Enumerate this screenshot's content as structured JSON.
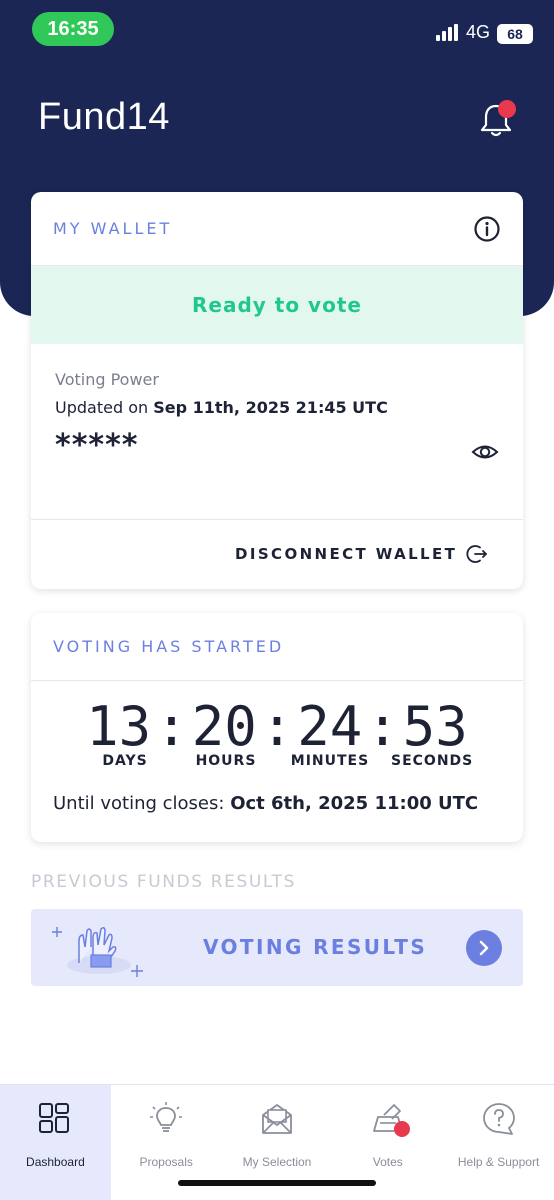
{
  "status_bar": {
    "time": "16:35",
    "network": "4G",
    "battery": "68"
  },
  "header": {
    "title": "Fund14",
    "bell_icon": "bell-icon"
  },
  "wallet": {
    "title": "MY WALLET",
    "status": "Ready to vote",
    "voting_power_label": "Voting Power",
    "updated_prefix": "Updated on",
    "updated_date": "Sep 11th, 2025 21:45 UTC",
    "voting_power_value": "*****",
    "disconnect_label": "DISCONNECT WALLET"
  },
  "voting": {
    "title": "VOTING HAS STARTED",
    "days": "13",
    "hours": "20",
    "minutes": "24",
    "seconds": "53",
    "days_label": "DAYS",
    "hours_label": "HOURS",
    "minutes_label": "MINUTES",
    "seconds_label": "SECONDS",
    "until_prefix": "Until voting closes:",
    "until_date": "Oct 6th, 2025 11:00 UTC"
  },
  "previous": {
    "title": "PREVIOUS FUNDS RESULTS",
    "banner_label": "VOTING RESULTS"
  },
  "nav": {
    "items": [
      {
        "label": "Dashboard",
        "icon": "dashboard-icon",
        "active": true
      },
      {
        "label": "Proposals",
        "icon": "lightbulb-icon",
        "active": false
      },
      {
        "label": "My Selection",
        "icon": "envelope-icon",
        "active": false
      },
      {
        "label": "Votes",
        "icon": "ballot-icon",
        "active": false
      },
      {
        "label": "Help & Support",
        "icon": "help-icon",
        "active": false
      }
    ]
  },
  "colors": {
    "header_bg": "#1b2655",
    "accent": "#6b7fe0",
    "ready_green": "#20c88a",
    "notification_red": "#e8394d"
  }
}
